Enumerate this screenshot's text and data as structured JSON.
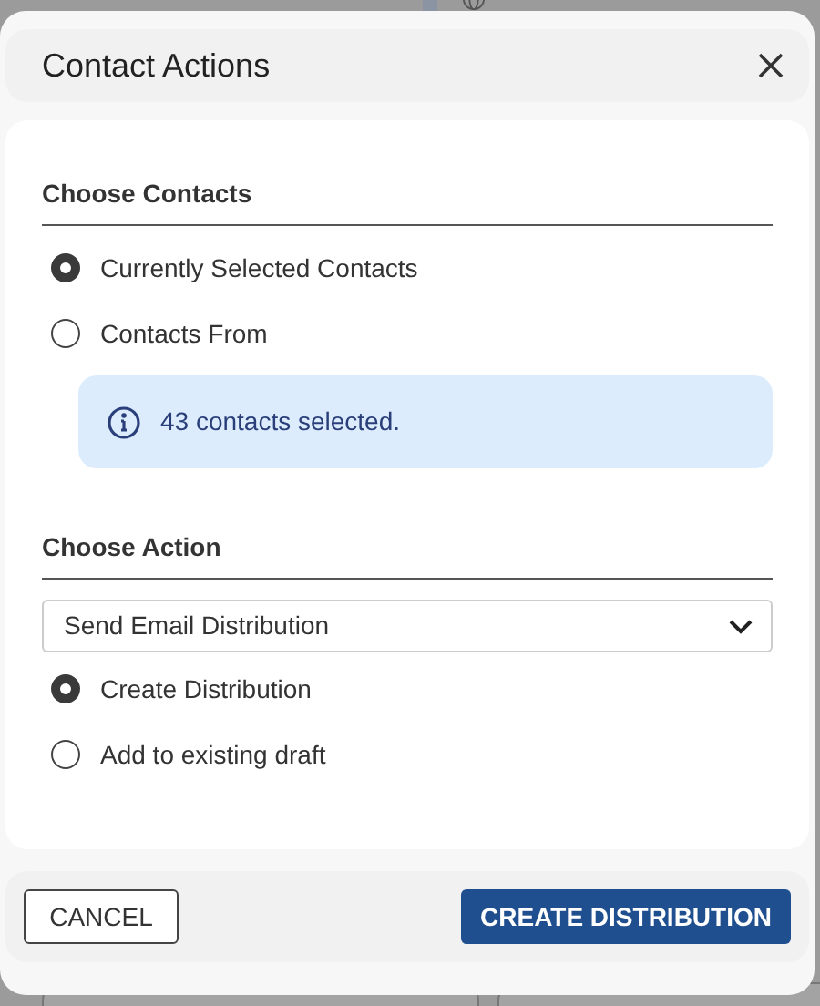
{
  "dialog": {
    "title": "Contact Actions"
  },
  "contacts_section": {
    "heading": "Choose Contacts",
    "options": [
      {
        "label": "Currently Selected Contacts",
        "selected": true
      },
      {
        "label": "Contacts From",
        "selected": false
      }
    ],
    "info": "43 contacts selected."
  },
  "action_section": {
    "heading": "Choose Action",
    "dropdown_value": "Send Email Distribution",
    "options": [
      {
        "label": "Create Distribution",
        "selected": true
      },
      {
        "label": "Add to existing draft",
        "selected": false
      }
    ]
  },
  "buttons": {
    "cancel": "CANCEL",
    "confirm": "CREATE DISTRIBUTION"
  }
}
